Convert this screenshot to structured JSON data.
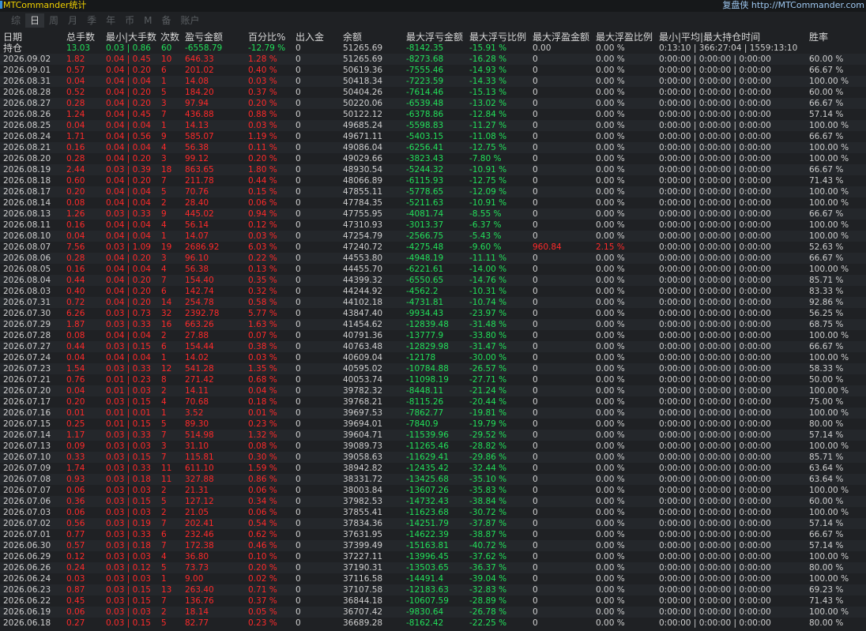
{
  "app_title": "MTCommander统计",
  "brand_prefix": "复盘侠",
  "brand_url": "http://MTCommander.com",
  "tabs": [
    {
      "label": "综",
      "active": false
    },
    {
      "label": "日",
      "active": true
    },
    {
      "label": "周",
      "active": false
    },
    {
      "label": "月",
      "active": false
    },
    {
      "label": "季",
      "active": false
    },
    {
      "label": "年",
      "active": false
    },
    {
      "label": "币",
      "active": false
    },
    {
      "label": "M",
      "active": false
    },
    {
      "label": "备",
      "active": false
    },
    {
      "label": "账户",
      "active": false
    }
  ],
  "columns": [
    "日期",
    "总手数",
    "最小|大手数",
    "次数",
    "盈亏金额",
    "百分比%",
    "出入金",
    "余额",
    "最大浮亏金额",
    "最大浮亏比例",
    "最大浮盈金额",
    "最大浮盈比例",
    "最小|平均|最大持仓时间",
    "胜率"
  ],
  "summary": [
    "持仓",
    "13.03",
    "0.03 | 0.86",
    "60",
    "-6558.79",
    "-12.79 %",
    "0",
    "51265.69",
    "-8142.35",
    "-15.91 %",
    "0.00",
    "0.00 %",
    "0:13:10 | 366:27:04 | 1559:13:10",
    ""
  ],
  "summary_colors": [
    "",
    "green",
    "green",
    "green",
    "green",
    "green",
    "white",
    "white",
    "green",
    "green",
    "white",
    "white",
    "white",
    "white"
  ],
  "rows": [
    [
      "2026.09.02",
      "1.82",
      "0.04 | 0.45",
      "10",
      "646.33",
      "1.28 %",
      "0",
      "51265.69",
      "-8273.68",
      "-16.28 %",
      "0",
      "0.00 %",
      "0:00:00 | 0:00:00 | 0:00:00",
      "60.00 %"
    ],
    [
      "2026.09.01",
      "0.57",
      "0.04 | 0.20",
      "6",
      "201.02",
      "0.40 %",
      "0",
      "50619.36",
      "-7555.46",
      "-14.93 %",
      "0",
      "0.00 %",
      "0:00:00 | 0:00:00 | 0:00:00",
      "66.67 %"
    ],
    [
      "2026.08.31",
      "0.04",
      "0.04 | 0.04",
      "1",
      "14.08",
      "0.03 %",
      "0",
      "50418.34",
      "-7223.59",
      "-14.33 %",
      "0",
      "0.00 %",
      "0:00:00 | 0:00:00 | 0:00:00",
      "100.00 %"
    ],
    [
      "2026.08.28",
      "0.52",
      "0.04 | 0.20",
      "5",
      "184.20",
      "0.37 %",
      "0",
      "50404.26",
      "-7614.46",
      "-15.13 %",
      "0",
      "0.00 %",
      "0:00:00 | 0:00:00 | 0:00:00",
      "60.00 %"
    ],
    [
      "2026.08.27",
      "0.28",
      "0.04 | 0.20",
      "3",
      "97.94",
      "0.20 %",
      "0",
      "50220.06",
      "-6539.48",
      "-13.02 %",
      "0",
      "0.00 %",
      "0:00:00 | 0:00:00 | 0:00:00",
      "66.67 %"
    ],
    [
      "2026.08.26",
      "1.24",
      "0.04 | 0.45",
      "7",
      "436.88",
      "0.88 %",
      "0",
      "50122.12",
      "-6378.86",
      "-12.84 %",
      "0",
      "0.00 %",
      "0:00:00 | 0:00:00 | 0:00:00",
      "57.14 %"
    ],
    [
      "2026.08.25",
      "0.04",
      "0.04 | 0.04",
      "1",
      "14.13",
      "0.03 %",
      "0",
      "49685.24",
      "-5598.83",
      "-11.27 %",
      "0",
      "0.00 %",
      "0:00:00 | 0:00:00 | 0:00:00",
      "100.00 %"
    ],
    [
      "2026.08.24",
      "1.71",
      "0.04 | 0.56",
      "9",
      "585.07",
      "1.19 %",
      "0",
      "49671.11",
      "-5403.15",
      "-11.08 %",
      "0",
      "0.00 %",
      "0:00:00 | 0:00:00 | 0:00:00",
      "66.67 %"
    ],
    [
      "2026.08.21",
      "0.16",
      "0.04 | 0.04",
      "4",
      "56.38",
      "0.11 %",
      "0",
      "49086.04",
      "-6256.41",
      "-12.75 %",
      "0",
      "0.00 %",
      "0:00:00 | 0:00:00 | 0:00:00",
      "100.00 %"
    ],
    [
      "2026.08.20",
      "0.28",
      "0.04 | 0.20",
      "3",
      "99.12",
      "0.20 %",
      "0",
      "49029.66",
      "-3823.43",
      "-7.80 %",
      "0",
      "0.00 %",
      "0:00:00 | 0:00:00 | 0:00:00",
      "100.00 %"
    ],
    [
      "2026.08.19",
      "2.44",
      "0.03 | 0.39",
      "18",
      "863.65",
      "1.80 %",
      "0",
      "48930.54",
      "-5244.32",
      "-10.91 %",
      "0",
      "0.00 %",
      "0:00:00 | 0:00:00 | 0:00:00",
      "66.67 %"
    ],
    [
      "2026.08.18",
      "0.60",
      "0.04 | 0.20",
      "7",
      "211.78",
      "0.44 %",
      "0",
      "48066.89",
      "-6115.93",
      "-12.75 %",
      "0",
      "0.00 %",
      "0:00:00 | 0:00:00 | 0:00:00",
      "71.43 %"
    ],
    [
      "2026.08.17",
      "0.20",
      "0.04 | 0.04",
      "5",
      "70.76",
      "0.15 %",
      "0",
      "47855.11",
      "-5778.65",
      "-12.09 %",
      "0",
      "0.00 %",
      "0:00:00 | 0:00:00 | 0:00:00",
      "100.00 %"
    ],
    [
      "2026.08.14",
      "0.08",
      "0.04 | 0.04",
      "2",
      "28.40",
      "0.06 %",
      "0",
      "47784.35",
      "-5211.63",
      "-10.91 %",
      "0",
      "0.00 %",
      "0:00:00 | 0:00:00 | 0:00:00",
      "100.00 %"
    ],
    [
      "2026.08.13",
      "1.26",
      "0.03 | 0.33",
      "9",
      "445.02",
      "0.94 %",
      "0",
      "47755.95",
      "-4081.74",
      "-8.55 %",
      "0",
      "0.00 %",
      "0:00:00 | 0:00:00 | 0:00:00",
      "66.67 %"
    ],
    [
      "2026.08.11",
      "0.16",
      "0.04 | 0.04",
      "4",
      "56.14",
      "0.12 %",
      "0",
      "47310.93",
      "-3013.37",
      "-6.37 %",
      "0",
      "0.00 %",
      "0:00:00 | 0:00:00 | 0:00:00",
      "100.00 %"
    ],
    [
      "2026.08.10",
      "0.04",
      "0.04 | 0.04",
      "1",
      "14.07",
      "0.03 %",
      "0",
      "47254.79",
      "-2566.75",
      "-5.43 %",
      "0",
      "0.00 %",
      "0:00:00 | 0:00:00 | 0:00:00",
      "100.00 %"
    ],
    [
      "2026.08.07",
      "7.56",
      "0.03 | 1.09",
      "19",
      "2686.92",
      "6.03 %",
      "0",
      "47240.72",
      "-4275.48",
      "-9.60 %",
      "960.84",
      "2.15 %",
      "0:00:00 | 0:00:00 | 0:00:00",
      "52.63 %"
    ],
    [
      "2026.08.06",
      "0.28",
      "0.04 | 0.20",
      "3",
      "96.10",
      "0.22 %",
      "0",
      "44553.80",
      "-4948.19",
      "-11.11 %",
      "0",
      "0.00 %",
      "0:00:00 | 0:00:00 | 0:00:00",
      "66.67 %"
    ],
    [
      "2026.08.05",
      "0.16",
      "0.04 | 0.04",
      "4",
      "56.38",
      "0.13 %",
      "0",
      "44455.70",
      "-6221.61",
      "-14.00 %",
      "0",
      "0.00 %",
      "0:00:00 | 0:00:00 | 0:00:00",
      "100.00 %"
    ],
    [
      "2026.08.04",
      "0.44",
      "0.04 | 0.20",
      "7",
      "154.40",
      "0.35 %",
      "0",
      "44399.32",
      "-6550.65",
      "-14.76 %",
      "0",
      "0.00 %",
      "0:00:00 | 0:00:00 | 0:00:00",
      "85.71 %"
    ],
    [
      "2026.08.03",
      "0.40",
      "0.04 | 0.20",
      "6",
      "142.74",
      "0.32 %",
      "0",
      "44244.92",
      "-4562.2",
      "-10.31 %",
      "0",
      "0.00 %",
      "0:00:00 | 0:00:00 | 0:00:00",
      "83.33 %"
    ],
    [
      "2026.07.31",
      "0.72",
      "0.04 | 0.20",
      "14",
      "254.78",
      "0.58 %",
      "0",
      "44102.18",
      "-4731.81",
      "-10.74 %",
      "0",
      "0.00 %",
      "0:00:00 | 0:00:00 | 0:00:00",
      "92.86 %"
    ],
    [
      "2026.07.30",
      "6.26",
      "0.03 | 0.73",
      "32",
      "2392.78",
      "5.77 %",
      "0",
      "43847.40",
      "-9934.43",
      "-23.97 %",
      "0",
      "0.00 %",
      "0:00:00 | 0:00:00 | 0:00:00",
      "56.25 %"
    ],
    [
      "2026.07.29",
      "1.87",
      "0.03 | 0.33",
      "16",
      "663.26",
      "1.63 %",
      "0",
      "41454.62",
      "-12839.48",
      "-31.48 %",
      "0",
      "0.00 %",
      "0:00:00 | 0:00:00 | 0:00:00",
      "68.75 %"
    ],
    [
      "2026.07.28",
      "0.08",
      "0.04 | 0.04",
      "2",
      "27.88",
      "0.07 %",
      "0",
      "40791.36",
      "-13777.9",
      "-33.80 %",
      "0",
      "0.00 %",
      "0:00:00 | 0:00:00 | 0:00:00",
      "100.00 %"
    ],
    [
      "2026.07.27",
      "0.44",
      "0.03 | 0.15",
      "6",
      "154.44",
      "0.38 %",
      "0",
      "40763.48",
      "-12829.98",
      "-31.47 %",
      "0",
      "0.00 %",
      "0:00:00 | 0:00:00 | 0:00:00",
      "66.67 %"
    ],
    [
      "2026.07.24",
      "0.04",
      "0.04 | 0.04",
      "1",
      "14.02",
      "0.03 %",
      "0",
      "40609.04",
      "-12178",
      "-30.00 %",
      "0",
      "0.00 %",
      "0:00:00 | 0:00:00 | 0:00:00",
      "100.00 %"
    ],
    [
      "2026.07.23",
      "1.54",
      "0.03 | 0.33",
      "12",
      "541.28",
      "1.35 %",
      "0",
      "40595.02",
      "-10784.88",
      "-26.57 %",
      "0",
      "0.00 %",
      "0:00:00 | 0:00:00 | 0:00:00",
      "58.33 %"
    ],
    [
      "2026.07.21",
      "0.76",
      "0.01 | 0.23",
      "8",
      "271.42",
      "0.68 %",
      "0",
      "40053.74",
      "-11098.19",
      "-27.71 %",
      "0",
      "0.00 %",
      "0:00:00 | 0:00:00 | 0:00:00",
      "50.00 %"
    ],
    [
      "2026.07.20",
      "0.04",
      "0.01 | 0.03",
      "2",
      "14.11",
      "0.04 %",
      "0",
      "39782.32",
      "-8448.11",
      "-21.24 %",
      "0",
      "0.00 %",
      "0:00:00 | 0:00:00 | 0:00:00",
      "100.00 %"
    ],
    [
      "2026.07.17",
      "0.20",
      "0.03 | 0.15",
      "4",
      "70.68",
      "0.18 %",
      "0",
      "39768.21",
      "-8115.26",
      "-20.44 %",
      "0",
      "0.00 %",
      "0:00:00 | 0:00:00 | 0:00:00",
      "75.00 %"
    ],
    [
      "2026.07.16",
      "0.01",
      "0.01 | 0.01",
      "1",
      "3.52",
      "0.01 %",
      "0",
      "39697.53",
      "-7862.77",
      "-19.81 %",
      "0",
      "0.00 %",
      "0:00:00 | 0:00:00 | 0:00:00",
      "100.00 %"
    ],
    [
      "2026.07.15",
      "0.25",
      "0.01 | 0.15",
      "5",
      "89.30",
      "0.23 %",
      "0",
      "39694.01",
      "-7840.9",
      "-19.79 %",
      "0",
      "0.00 %",
      "0:00:00 | 0:00:00 | 0:00:00",
      "80.00 %"
    ],
    [
      "2026.07.14",
      "1.17",
      "0.03 | 0.33",
      "7",
      "514.98",
      "1.32 %",
      "0",
      "39604.71",
      "-11539.96",
      "-29.52 %",
      "0",
      "0.00 %",
      "0:00:00 | 0:00:00 | 0:00:00",
      "57.14 %"
    ],
    [
      "2026.07.13",
      "0.09",
      "0.03 | 0.03",
      "3",
      "31.10",
      "0.08 %",
      "0",
      "39089.73",
      "-11265.46",
      "-28.82 %",
      "0",
      "0.00 %",
      "0:00:00 | 0:00:00 | 0:00:00",
      "100.00 %"
    ],
    [
      "2026.07.10",
      "0.33",
      "0.03 | 0.15",
      "7",
      "115.81",
      "0.30 %",
      "0",
      "39058.63",
      "-11629.41",
      "-29.86 %",
      "0",
      "0.00 %",
      "0:00:00 | 0:00:00 | 0:00:00",
      "85.71 %"
    ],
    [
      "2026.07.09",
      "1.74",
      "0.03 | 0.33",
      "11",
      "611.10",
      "1.59 %",
      "0",
      "38942.82",
      "-12435.42",
      "-32.44 %",
      "0",
      "0.00 %",
      "0:00:00 | 0:00:00 | 0:00:00",
      "63.64 %"
    ],
    [
      "2026.07.08",
      "0.93",
      "0.03 | 0.18",
      "11",
      "327.88",
      "0.86 %",
      "0",
      "38331.72",
      "-13425.68",
      "-35.10 %",
      "0",
      "0.00 %",
      "0:00:00 | 0:00:00 | 0:00:00",
      "63.64 %"
    ],
    [
      "2026.07.07",
      "0.06",
      "0.03 | 0.03",
      "2",
      "21.31",
      "0.06 %",
      "0",
      "38003.84",
      "-13607.26",
      "-35.83 %",
      "0",
      "0.00 %",
      "0:00:00 | 0:00:00 | 0:00:00",
      "100.00 %"
    ],
    [
      "2026.07.06",
      "0.36",
      "0.03 | 0.15",
      "5",
      "127.12",
      "0.34 %",
      "0",
      "37982.53",
      "-14732.43",
      "-38.84 %",
      "0",
      "0.00 %",
      "0:00:00 | 0:00:00 | 0:00:00",
      "60.00 %"
    ],
    [
      "2026.07.03",
      "0.06",
      "0.03 | 0.03",
      "2",
      "21.05",
      "0.06 %",
      "0",
      "37855.41",
      "-11623.68",
      "-30.72 %",
      "0",
      "0.00 %",
      "0:00:00 | 0:00:00 | 0:00:00",
      "100.00 %"
    ],
    [
      "2026.07.02",
      "0.56",
      "0.03 | 0.19",
      "7",
      "202.41",
      "0.54 %",
      "0",
      "37834.36",
      "-14251.79",
      "-37.87 %",
      "0",
      "0.00 %",
      "0:00:00 | 0:00:00 | 0:00:00",
      "57.14 %"
    ],
    [
      "2026.07.01",
      "0.77",
      "0.03 | 0.33",
      "6",
      "232.46",
      "0.62 %",
      "0",
      "37631.95",
      "-14622.39",
      "-38.87 %",
      "0",
      "0.00 %",
      "0:00:00 | 0:00:00 | 0:00:00",
      "66.67 %"
    ],
    [
      "2026.06.30",
      "0.57",
      "0.03 | 0.18",
      "7",
      "172.38",
      "0.46 %",
      "0",
      "37399.49",
      "-15163.81",
      "-40.72 %",
      "0",
      "0.00 %",
      "0:00:00 | 0:00:00 | 0:00:00",
      "57.14 %"
    ],
    [
      "2026.06.29",
      "0.12",
      "0.03 | 0.03",
      "4",
      "36.80",
      "0.10 %",
      "0",
      "37227.11",
      "-13996.45",
      "-37.62 %",
      "0",
      "0.00 %",
      "0:00:00 | 0:00:00 | 0:00:00",
      "100.00 %"
    ],
    [
      "2026.06.26",
      "0.24",
      "0.03 | 0.12",
      "5",
      "73.73",
      "0.20 %",
      "0",
      "37190.31",
      "-13503.65",
      "-36.37 %",
      "0",
      "0.00 %",
      "0:00:00 | 0:00:00 | 0:00:00",
      "80.00 %"
    ],
    [
      "2026.06.24",
      "0.03",
      "0.03 | 0.03",
      "1",
      "9.00",
      "0.02 %",
      "0",
      "37116.58",
      "-14491.4",
      "-39.04 %",
      "0",
      "0.00 %",
      "0:00:00 | 0:00:00 | 0:00:00",
      "100.00 %"
    ],
    [
      "2026.06.23",
      "0.87",
      "0.03 | 0.15",
      "13",
      "263.40",
      "0.71 %",
      "0",
      "37107.58",
      "-12183.63",
      "-32.83 %",
      "0",
      "0.00 %",
      "0:00:00 | 0:00:00 | 0:00:00",
      "69.23 %"
    ],
    [
      "2026.06.22",
      "0.45",
      "0.03 | 0.15",
      "7",
      "136.76",
      "0.37 %",
      "0",
      "36844.18",
      "-10607.59",
      "-28.89 %",
      "0",
      "0.00 %",
      "0:00:00 | 0:00:00 | 0:00:00",
      "71.43 %"
    ],
    [
      "2026.06.19",
      "0.06",
      "0.03 | 0.03",
      "2",
      "18.14",
      "0.05 %",
      "0",
      "36707.42",
      "-9830.64",
      "-26.78 %",
      "0",
      "0.00 %",
      "0:00:00 | 0:00:00 | 0:00:00",
      "100.00 %"
    ],
    [
      "2026.06.18",
      "0.27",
      "0.03 | 0.15",
      "5",
      "82.77",
      "0.23 %",
      "0",
      "36689.28",
      "-8162.42",
      "-22.25 %",
      "0",
      "0.00 %",
      "0:00:00 | 0:00:00 | 0:00:00",
      "80.00 %"
    ]
  ],
  "colors": {
    "background": "#1f2124",
    "positive": "#ff2a2a",
    "negative": "#22e05a",
    "neutral": "#cfcfcf",
    "title": "#f0d000",
    "brand": "#9ec7f0"
  }
}
